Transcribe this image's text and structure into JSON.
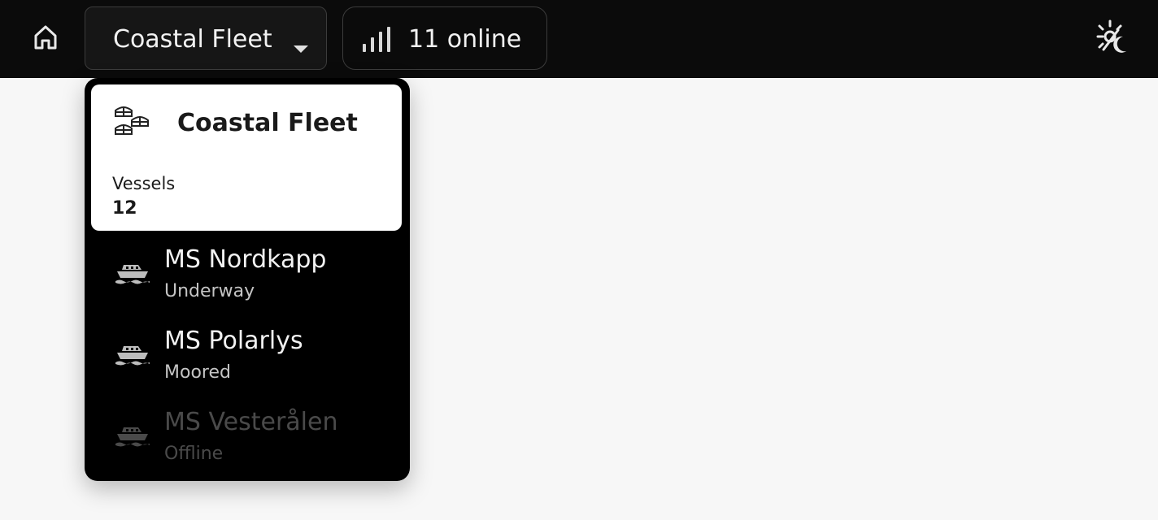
{
  "header": {
    "fleet_selector": {
      "selected": "Coastal Fleet"
    },
    "online_status": {
      "label": "11 online"
    },
    "icons": {
      "home": "home-icon",
      "caret": "caret-down-icon",
      "signal": "signal-bars-icon",
      "theme": "sun-moon-icon"
    }
  },
  "dropdown": {
    "fleet_card": {
      "name": "Coastal Fleet",
      "icon": "fleet-boats-icon",
      "stat_label": "Vessels",
      "stat_value": "12"
    },
    "vessels": [
      {
        "name": "MS Nordkapp",
        "status": "Underway",
        "icon": "ship-icon"
      },
      {
        "name": "MS Polarlys",
        "status": "Moored",
        "icon": "ship-icon"
      },
      {
        "name": "MS Vesterålen",
        "status": "Offline",
        "icon": "ship-icon"
      }
    ]
  },
  "colors": {
    "topbar_bg": "#0b0b0b",
    "page_bg": "#f7f7f7",
    "dropdown_bg": "#000000",
    "card_bg": "#ffffff",
    "offline_text": "#4a4a4a"
  }
}
